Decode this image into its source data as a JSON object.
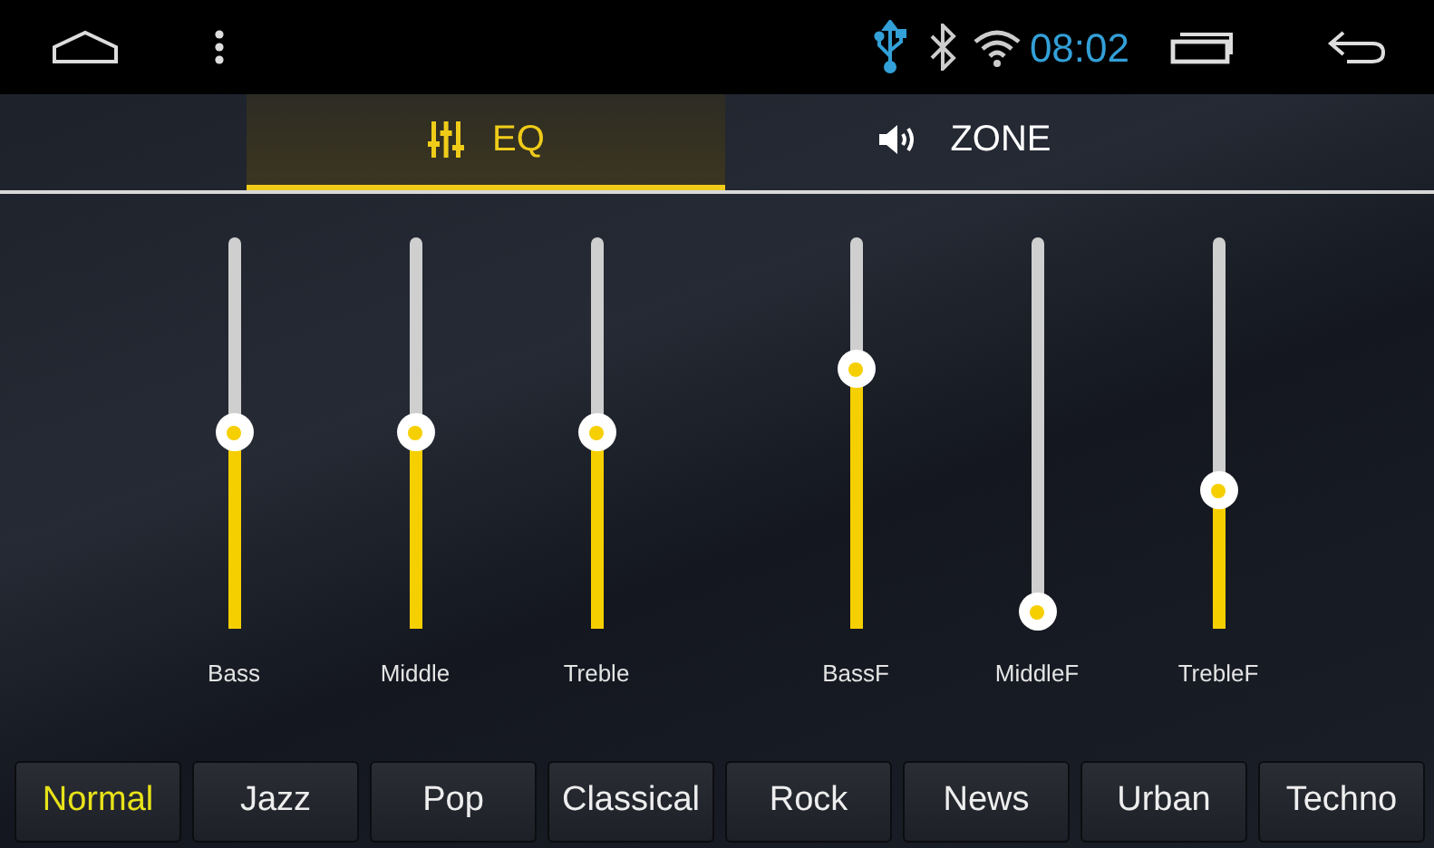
{
  "status_bar": {
    "time": "08:02"
  },
  "tabs": [
    {
      "label": "EQ",
      "selected": true
    },
    {
      "label": "ZONE",
      "selected": false
    }
  ],
  "eq_groups": [
    [
      {
        "name": "Bass",
        "level": 0.5
      },
      {
        "name": "Middle",
        "level": 0.5
      },
      {
        "name": "Treble",
        "level": 0.5
      }
    ],
    [
      {
        "name": "BassF",
        "level": 0.66
      },
      {
        "name": "MiddleF",
        "level": 0.04
      },
      {
        "name": "TrebleF",
        "level": 0.35
      }
    ]
  ],
  "presets": [
    {
      "label": "Normal",
      "selected": true
    },
    {
      "label": "Jazz",
      "selected": false
    },
    {
      "label": "Pop",
      "selected": false
    },
    {
      "label": "Classical",
      "selected": false
    },
    {
      "label": "Rock",
      "selected": false
    },
    {
      "label": "News",
      "selected": false
    },
    {
      "label": "Urban",
      "selected": false
    },
    {
      "label": "Techno",
      "selected": false
    }
  ]
}
